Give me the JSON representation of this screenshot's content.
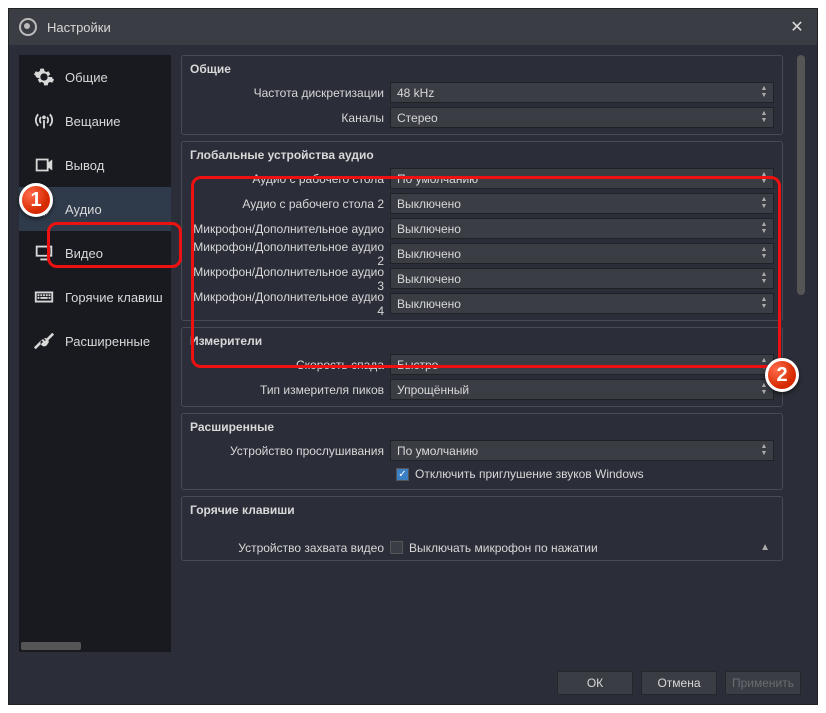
{
  "window": {
    "title": "Настройки"
  },
  "sidebar": {
    "items": [
      {
        "label": "Общие"
      },
      {
        "label": "Вещание"
      },
      {
        "label": "Вывод"
      },
      {
        "label": "Аудио"
      },
      {
        "label": "Видео"
      },
      {
        "label": "Горячие клавиш"
      },
      {
        "label": "Расширенные"
      }
    ]
  },
  "groups": {
    "general": {
      "title": "Общие",
      "sample_rate": {
        "label": "Частота дискретизации",
        "value": "48 kHz"
      },
      "channels": {
        "label": "Каналы",
        "value": "Стерео"
      }
    },
    "global_audio": {
      "title": "Глобальные устройства аудио",
      "rows": [
        {
          "label": "Аудио с рабочего стола",
          "value": "По умолчанию"
        },
        {
          "label": "Аудио с рабочего стола 2",
          "value": "Выключено"
        },
        {
          "label": "Микрофон/Дополнительное аудио",
          "value": "Выключено"
        },
        {
          "label": "Микрофон/Дополнительное аудио 2",
          "value": "Выключено"
        },
        {
          "label": "Микрофон/Дополнительное аудио 3",
          "value": "Выключено"
        },
        {
          "label": "Микрофон/Дополнительное аудио 4",
          "value": "Выключено"
        }
      ]
    },
    "meters": {
      "title": "Измерители",
      "decay": {
        "label": "Скорость спада",
        "value": "Быстро"
      },
      "peak": {
        "label": "Тип измерителя пиков",
        "value": "Упрощённый"
      }
    },
    "advanced": {
      "title": "Расширенные",
      "monitor": {
        "label": "Устройство прослушивания",
        "value": "По умолчанию"
      },
      "ducking": "Отключить приглушение звуков Windows"
    },
    "hotkeys": {
      "title": "Горячие клавиши",
      "capture": {
        "label": "Устройство захвата видео",
        "checkbox": "Выключать микрофон по нажатии"
      }
    }
  },
  "footer": {
    "ok": "ОК",
    "cancel": "Отмена",
    "apply": "Применить"
  },
  "badges": {
    "one": "1",
    "two": "2"
  }
}
